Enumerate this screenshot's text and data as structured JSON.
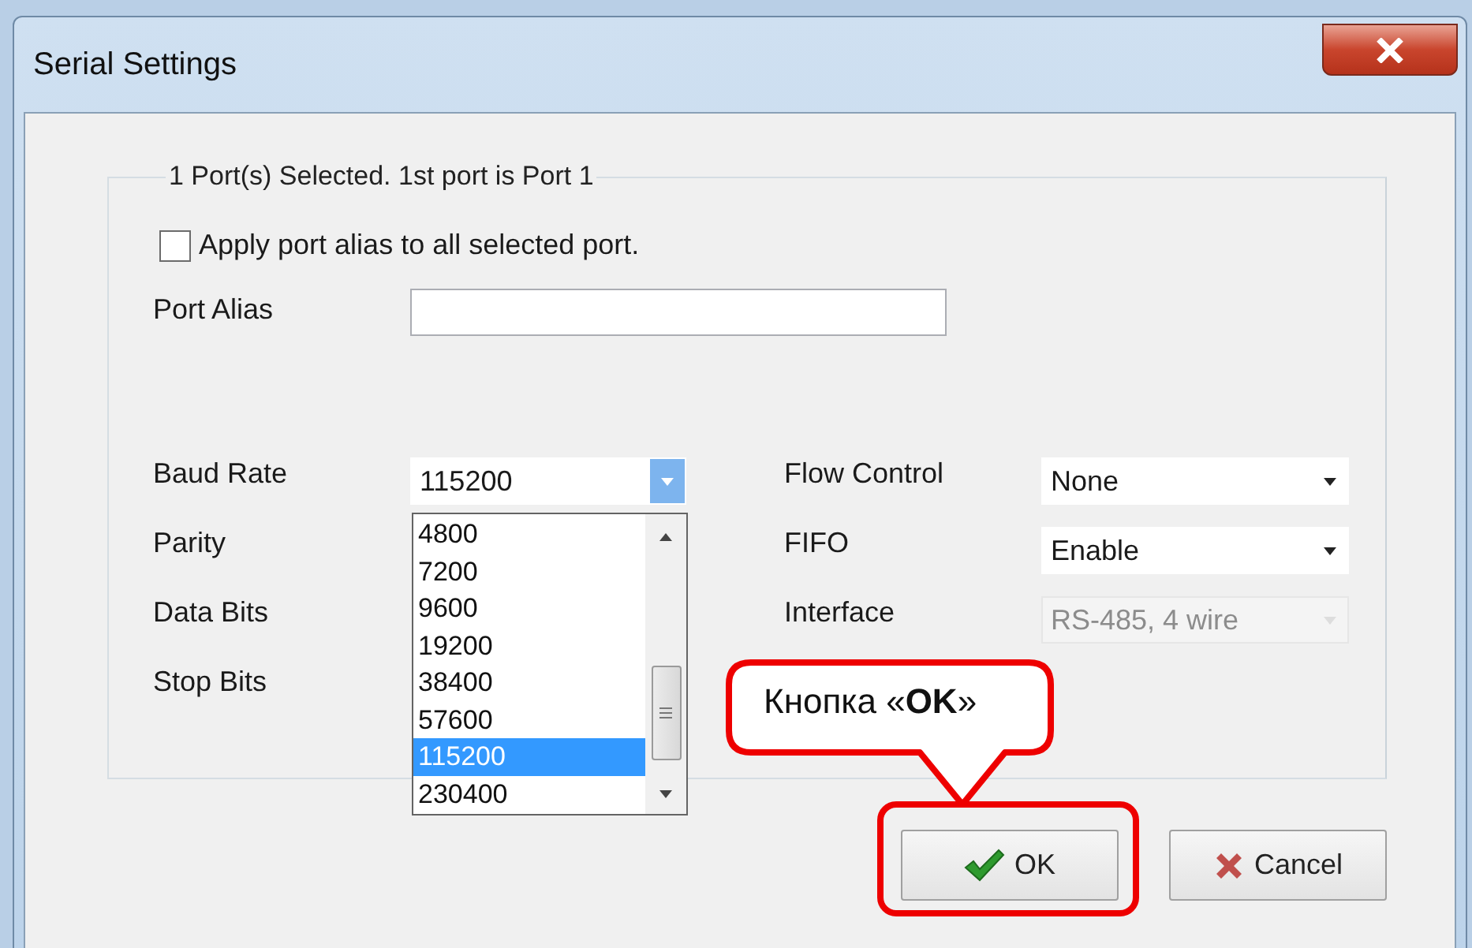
{
  "window": {
    "title": "Serial Settings"
  },
  "group": {
    "title": "1 Port(s) Selected. 1st port is Port 1",
    "apply_alias": {
      "label": "Apply port alias to all selected port.",
      "checked": false
    },
    "port_alias": {
      "label": "Port Alias"
    },
    "left_fields": [
      {
        "label": "Baud Rate",
        "value": "115200",
        "expanded": true,
        "options": [
          {
            "text": "4800",
            "selected": false
          },
          {
            "text": "7200",
            "selected": false
          },
          {
            "text": "9600",
            "selected": false
          },
          {
            "text": "19200",
            "selected": false
          },
          {
            "text": "38400",
            "selected": false
          },
          {
            "text": "57600",
            "selected": false
          },
          {
            "text": "115200",
            "selected": true
          },
          {
            "text": "230400",
            "selected": false
          }
        ]
      },
      {
        "label": "Parity"
      },
      {
        "label": "Data Bits"
      },
      {
        "label": "Stop Bits"
      }
    ],
    "right_fields": [
      {
        "label": "Flow Control",
        "value": "None",
        "disabled": false
      },
      {
        "label": "FIFO",
        "value": "Enable",
        "disabled": false
      },
      {
        "label": "Interface",
        "value": "RS-485, 4 wire",
        "disabled": true
      }
    ]
  },
  "buttons": [
    {
      "kind": "ok",
      "label": "OK",
      "highlighted": true
    },
    {
      "kind": "cancel",
      "label": "Cancel",
      "highlighted": false
    }
  ],
  "callout": {
    "text": "Кнопка «**OK**»"
  }
}
